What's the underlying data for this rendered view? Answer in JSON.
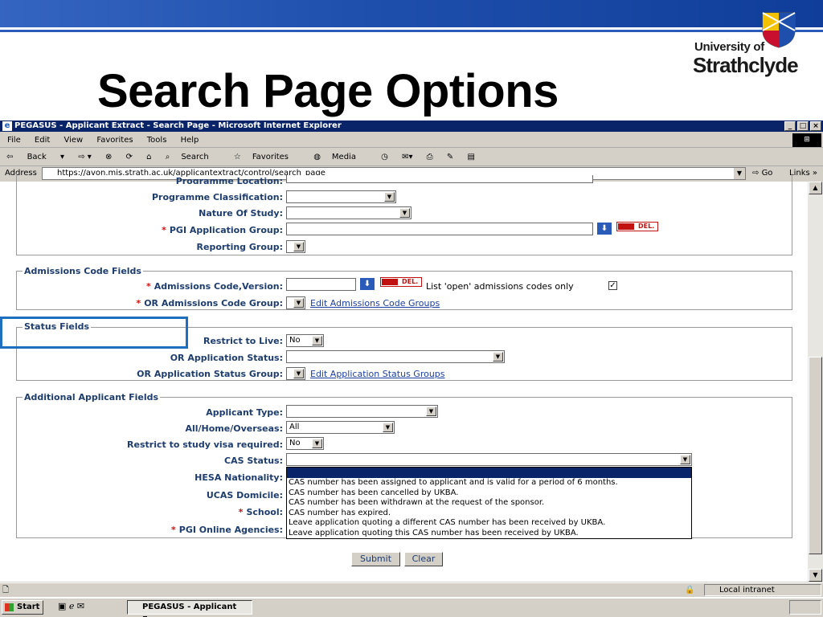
{
  "slide": {
    "title": "Search Page Options",
    "logo_line1": "University of",
    "logo_line2": "Strathclyde"
  },
  "browser": {
    "window_title": "PEGASUS - Applicant Extract - Search Page - Microsoft Internet Explorer",
    "menu": [
      "File",
      "Edit",
      "View",
      "Favorites",
      "Tools",
      "Help"
    ],
    "toolbar": [
      "Back",
      "Search",
      "Favorites",
      "Media"
    ],
    "address_label": "Address",
    "address_url": "https://avon.mis.strath.ac.uk/applicantextract/control/search_page",
    "go_label": "Go",
    "links_label": "Links",
    "status_zone": "Local intranet",
    "taskbar_start": "Start",
    "taskbar_task": "PEGASUS - Applicant E..."
  },
  "form": {
    "programme_location_label": "Programme Location:",
    "programme_classification_label": "Programme Classification:",
    "nature_of_study_label": "Nature Of Study:",
    "pgi_application_group_label": "PGI Application Group:",
    "reporting_group_label": "Reporting Group:",
    "admissions_legend": "Admissions Code Fields",
    "admissions_code_label": "Admissions Code,Version:",
    "open_codes_text": "List 'open' admissions codes only",
    "or_admissions_group_label": "OR Admissions Code Group:",
    "edit_admissions_link": "Edit Admissions Code Groups",
    "status_legend": "Status Fields",
    "restrict_live_label": "Restrict to Live:",
    "restrict_live_value": "No",
    "or_app_status_label": "OR Application Status:",
    "or_app_status_group_label": "OR Application Status Group:",
    "edit_status_link": "Edit Application Status Groups",
    "additional_legend": "Additional Applicant Fields",
    "applicant_type_label": "Applicant Type:",
    "home_overseas_label": "All/Home/Overseas:",
    "home_overseas_value": "All",
    "restrict_visa_label": "Restrict to study visa required:",
    "restrict_visa_value": "No",
    "cas_status_label": "CAS Status:",
    "hesa_nationality_label": "HESA Nationality:",
    "ucas_domicile_label": "UCAS Domicile:",
    "school_label": "School:",
    "pgi_online_agencies_label": "PGI Online Agencies:",
    "required_marker": "*",
    "del_label": "DEL.",
    "cas_options": [
      "",
      "CAS number has been assigned to applicant and is valid for a period of 6 months.",
      "CAS number has been cancelled by UKBA.",
      "CAS number has been withdrawn at the request of the sponsor.",
      "CAS number has expired.",
      "Leave application quoting a different CAS number has been received by UKBA.",
      "Leave application quoting this CAS number has been received by UKBA."
    ],
    "submit_label": "Submit",
    "clear_label": "Clear"
  }
}
